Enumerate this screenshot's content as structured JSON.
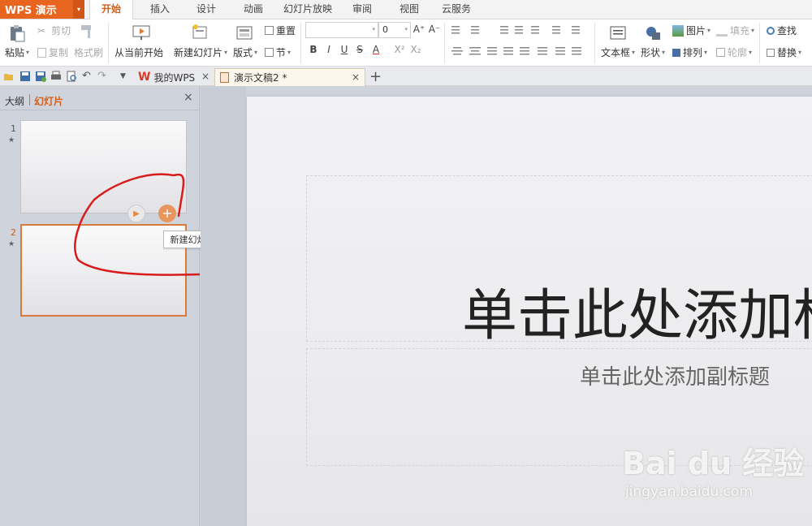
{
  "app": {
    "logo_text": "WPS 演示",
    "dropdown_arrow": "▾"
  },
  "menu": {
    "tabs": [
      "开始",
      "插入",
      "设计",
      "动画",
      "幻灯片放映",
      "审阅",
      "视图",
      "云服务"
    ],
    "active_index": 0
  },
  "ribbon": {
    "paste": "粘贴",
    "cut": "剪切",
    "copy": "复制",
    "format_painter": "格式刷",
    "from_current": "从当前开始",
    "new_slide": "新建幻灯片",
    "layout": "版式",
    "reset": "重置",
    "section": "节",
    "font_size_value": "0",
    "bold": "B",
    "italic": "I",
    "underline": "U",
    "strike": "S",
    "font_color": "A",
    "superscript": "X²",
    "subscript": "X₂",
    "text_box": "文本框",
    "shape": "形状",
    "picture": "图片",
    "fill": "填充",
    "arrange": "排列",
    "outline": "轮廓",
    "find": "查找",
    "replace": "替换"
  },
  "tabbar": {
    "tabs": [
      {
        "label": "我的WPS",
        "active": false
      },
      {
        "label": "演示文稿2 *",
        "active": true
      }
    ],
    "new_tab": "+",
    "close_glyph": "×"
  },
  "panel": {
    "outline_tab": "大纲",
    "slides_tab": "幻灯片",
    "close_glyph": "×",
    "slides": [
      {
        "number": "1",
        "star": "★",
        "selected": false
      },
      {
        "number": "2",
        "star": "★",
        "selected": true
      }
    ],
    "tooltip": "新建幻灯片"
  },
  "slide": {
    "title_placeholder": "单击此处添加标题",
    "subtitle_placeholder": "单击此处添加副标题"
  },
  "watermark": {
    "logo": "Bai du 经验",
    "url": "jingyan.baidu.com"
  },
  "colors": {
    "accent": "#e8651f",
    "active_tab_text": "#d2601a",
    "selected_thumb_border": "#d87a3a",
    "annotation": "#d81c1c"
  }
}
